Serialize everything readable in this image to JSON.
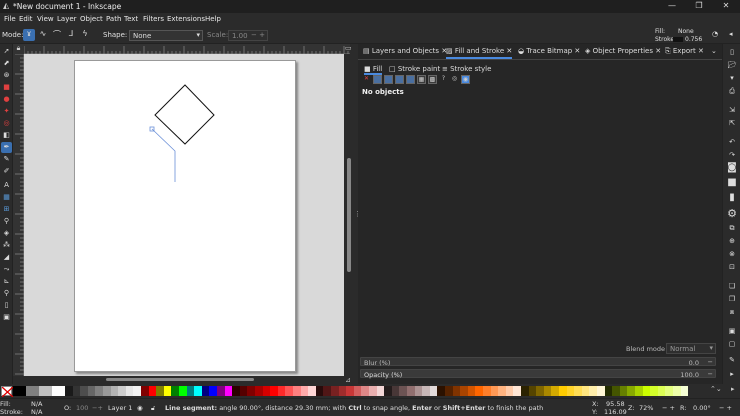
{
  "window": {
    "title": "*New document 1 - Inkscape",
    "logo_icon": "inkscape-icon"
  },
  "menu": [
    "File",
    "Edit",
    "View",
    "Layer",
    "Object",
    "Path",
    "Text",
    "Filters",
    "Extensions",
    "Help"
  ],
  "tool_controls": {
    "mode_label": "Mode:",
    "shape_label": "Shape:",
    "shape_value": "None",
    "scale_label": "Scale:",
    "scale_value": "1.00",
    "fill_label": "Fill:",
    "fill_value": "None",
    "stroke_label": "Stroke:",
    "stroke_width": "0.756"
  },
  "panel": {
    "tabs": [
      "Layers and Objects",
      "Fill and Stroke",
      "Trace Bitmap",
      "Object Properties",
      "Export"
    ],
    "active_tab": "Fill and Stroke",
    "subtabs": [
      "Fill",
      "Stroke paint",
      "Stroke style"
    ],
    "no_objects": "No objects",
    "blend_label": "Blend mode",
    "blend_value": "Normal",
    "blur_label": "Blur (%)",
    "blur_value": "0.0",
    "opacity_label": "Opacity (%)",
    "opacity_value": "100.0"
  },
  "status": {
    "fill_label": "Fill:",
    "fill_value": "N/A",
    "stroke_label": "Stroke:",
    "stroke_value": "N/A",
    "opacity_label": "O:",
    "opacity_value": "100",
    "layer": "Layer 1",
    "message_parts": [
      "Line segment:",
      " angle 90.00°, distance 29.30 mm; with ",
      "Ctrl",
      " to snap angle, ",
      "Enter",
      " or ",
      "Shift+Enter",
      " to finish the path"
    ],
    "x_label": "X:",
    "x_value": "95.58",
    "y_label": "Y:",
    "y_value": "116.09",
    "zoom_label": "Z:",
    "zoom_value": "72%",
    "rotation_label": "R:",
    "rotation_value": "0.00°"
  },
  "colors": {
    "accent": "#3a6fb0",
    "tab_underline": "#4a8adf",
    "path_preview": "#6a8fd8"
  }
}
